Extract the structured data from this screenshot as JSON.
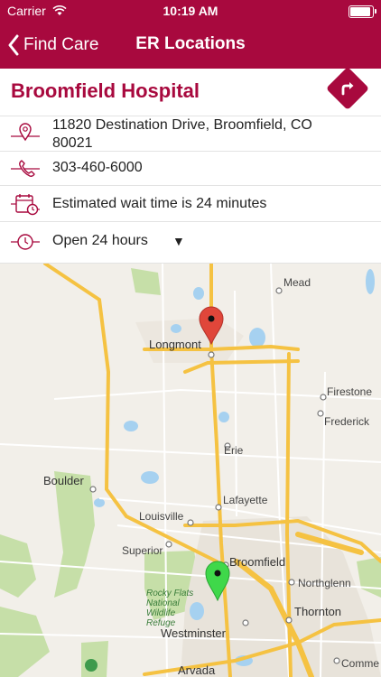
{
  "status_bar": {
    "carrier": "Carrier",
    "time": "10:19 AM"
  },
  "nav": {
    "back_label": "Find Care",
    "title": "ER Locations"
  },
  "hospital": {
    "name": "Broomfield Hospital",
    "address_line1": "11820 Destination Drive, Broomfield, CO",
    "address_line2": "80021",
    "phone": "303-460-6000",
    "wait_time": "Estimated wait time is 24 minutes",
    "hours": "Open 24 hours"
  },
  "map": {
    "labels": {
      "mead": "Mead",
      "longmont": "Longmont",
      "firestone": "Firestone",
      "frederick": "Frederick",
      "erie": "Erie",
      "boulder": "Boulder",
      "lafayette": "Lafayette",
      "louisville": "Louisville",
      "superior": "Superior",
      "broomfield": "Broomfield",
      "northglenn": "Northglenn",
      "thornton": "Thornton",
      "rocky_flats": "Rocky Flats National Wildlife Refuge",
      "westminster": "Westminster",
      "arvada": "Arvada",
      "commerce": "Comme"
    },
    "pins": [
      "red-location-pin",
      "green-location-pin"
    ]
  },
  "colors": {
    "brand": "#a8093e",
    "road_yellow": "#f5c242",
    "water": "#a6d1f0",
    "park": "#c6dfa8"
  }
}
